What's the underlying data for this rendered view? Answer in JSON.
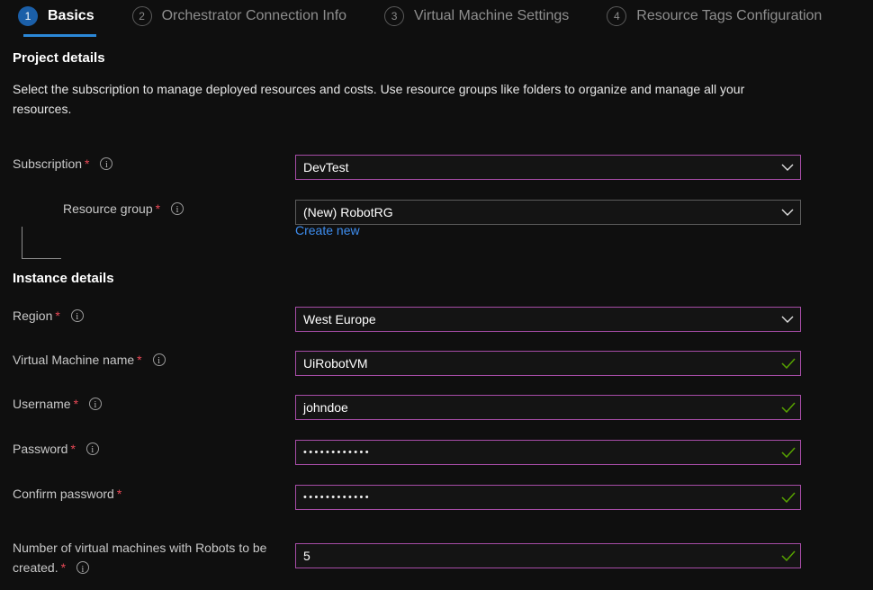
{
  "wizard": {
    "tabs": [
      {
        "number": "1",
        "label": "Basics",
        "state": "active"
      },
      {
        "number": "2",
        "label": "Orchestrator Connection Info",
        "state": "inactive"
      },
      {
        "number": "3",
        "label": "Virtual Machine Settings",
        "state": "inactive"
      },
      {
        "number": "4",
        "label": "Resource Tags Configuration",
        "state": "inactive"
      }
    ]
  },
  "project_details": {
    "title": "Project details",
    "description": "Select the subscription to manage deployed resources and costs. Use resource groups like folders to organize and manage all your resources.",
    "subscription": {
      "label": "Subscription",
      "required": "*",
      "value": "DevTest",
      "icon": "chevron-down-icon"
    },
    "resource_group": {
      "label": "Resource group",
      "required": "*",
      "value": "(New) RobotRG",
      "icon": "chevron-down-icon",
      "create_new_label": "Create new"
    }
  },
  "instance_details": {
    "title": "Instance details",
    "region": {
      "label": "Region",
      "required": "*",
      "value": "West Europe",
      "icon": "chevron-down-icon"
    },
    "vm_name": {
      "label": "Virtual Machine name",
      "required": "*",
      "value": "UiRobotVM",
      "icon": "checkmark-icon"
    },
    "username": {
      "label": "Username",
      "required": "*",
      "value": "johndoe",
      "icon": "checkmark-icon"
    },
    "password": {
      "label": "Password",
      "required": "*",
      "value": "••••••••••••",
      "icon": "checkmark-icon"
    },
    "confirm_password": {
      "label": "Confirm password",
      "required": "*",
      "value": "••••••••••••",
      "icon": "checkmark-icon"
    },
    "vm_count": {
      "label": "Number of virtual machines with Robots to be created.",
      "required": "*",
      "value": "5",
      "icon": "checkmark-icon"
    }
  },
  "colors": {
    "background": "#0f0f0f",
    "accent_blue": "#2b88d8",
    "tab_badge_active": "#1b5fa8",
    "field_border_focus": "#a64ca6",
    "field_border_plain": "#5c5c5c",
    "required_red": "#e74856",
    "valid_green": "#57a300",
    "link_blue": "#3e8ef0"
  }
}
